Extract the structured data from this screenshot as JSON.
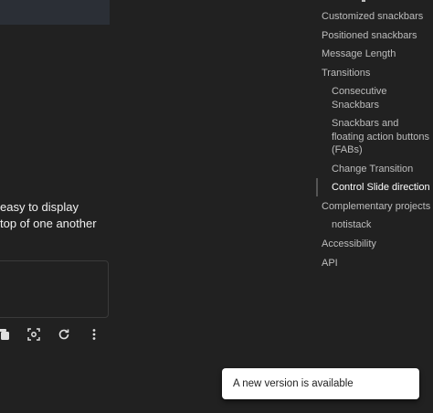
{
  "content": {
    "text_line_1": "easy to display",
    "text_line_2": "top of one another"
  },
  "toolbar": {
    "icons": [
      "copy-icon",
      "fullscreen-icon",
      "reload-icon",
      "more-vert-icon"
    ]
  },
  "toc": {
    "items": [
      {
        "label": "Customized snackbars",
        "level": 1
      },
      {
        "label": "Positioned snackbars",
        "level": 1
      },
      {
        "label": "Message Length",
        "level": 1
      },
      {
        "label": "Transitions",
        "level": 1
      },
      {
        "label": "Consecutive Snackbars",
        "level": 2
      },
      {
        "label": "Snackbars and floating action buttons (FABs)",
        "level": 2
      },
      {
        "label": "Change Transition",
        "level": 2
      },
      {
        "label": "Control Slide direction",
        "level": 2,
        "active": true
      },
      {
        "label": "Complementary projects",
        "level": 1
      },
      {
        "label": "notistack",
        "level": 2
      },
      {
        "label": "Accessibility",
        "level": 1
      },
      {
        "label": "API",
        "level": 1
      }
    ]
  },
  "snackbar": {
    "message": "A new version is available"
  },
  "colors": {
    "background": "#212121",
    "snackbar_bg": "#ffffff",
    "text": "#e6e6e6"
  }
}
